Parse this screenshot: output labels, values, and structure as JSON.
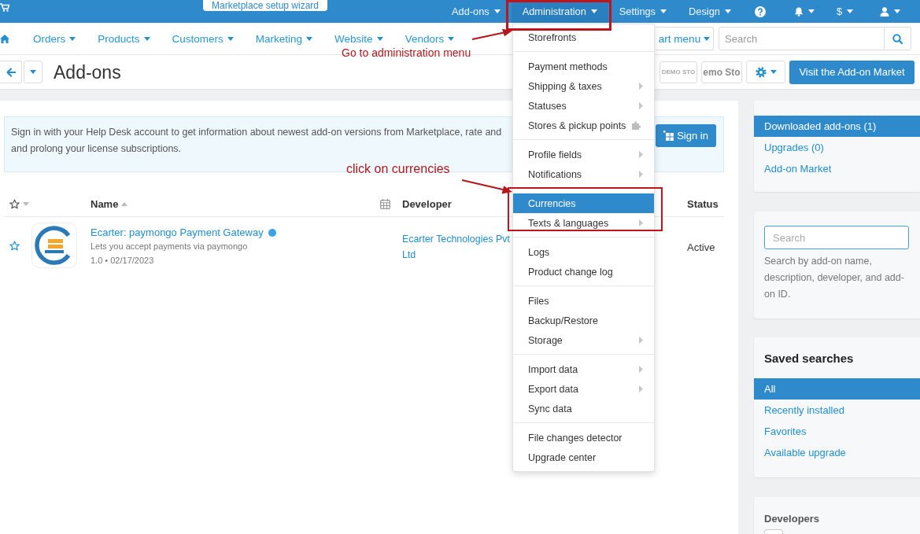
{
  "top_bar": {
    "setup_wizard": "Marketplace setup wizard",
    "menu": [
      {
        "label": "Add-ons",
        "selected": false
      },
      {
        "label": "Administration",
        "selected": true
      },
      {
        "label": "Settings",
        "selected": false
      },
      {
        "label": "Design",
        "selected": false
      }
    ],
    "currency": "$"
  },
  "nav": {
    "items": [
      "Orders",
      "Products",
      "Customers",
      "Marketing",
      "Website",
      "Vendors"
    ],
    "quick_menu": "art menu",
    "search": {
      "placeholder": "Search"
    }
  },
  "header": {
    "title": "Add-ons",
    "storefronts": [
      "DEMO STO",
      "emo Sto"
    ],
    "market_button": "Visit the Add-on Market"
  },
  "notice": {
    "lines": [
      "Sign in with your Help Desk account to get information about newest add-on versions from Marketplace, rate and",
      "and prolong your license subscriptions."
    ],
    "button": "Sign in"
  },
  "table": {
    "columns": [
      {
        "kind": "favorite"
      },
      {
        "kind": "name",
        "label": "Name",
        "sorted": true
      },
      {
        "kind": "date"
      },
      {
        "kind": "developer",
        "label": "Developer"
      },
      {
        "kind": "status",
        "label": "Status"
      }
    ],
    "rows": [
      {
        "favorite": false,
        "name": "Ecarter: paymongo Payment Gateway",
        "verified": true,
        "description": "Lets you accept payments via paymongo",
        "meta": "1.0 • 02/17/2023",
        "developer": "Ecarter Technologies Pvt Ltd",
        "status": "Active"
      }
    ]
  },
  "admin_menu": {
    "groups": [
      {
        "items": [
          {
            "label": "Storefronts",
            "kind": "link",
            "selected": false
          }
        ]
      },
      {
        "items": [
          {
            "label": "Payment methods",
            "kind": "link",
            "selected": false
          },
          {
            "label": "Shipping & taxes",
            "kind": "submenu",
            "selected": false
          },
          {
            "label": "Statuses",
            "kind": "submenu",
            "selected": false
          },
          {
            "label": "Stores & pickup points",
            "kind": "addon",
            "selected": false
          }
        ]
      },
      {
        "items": [
          {
            "label": "Profile fields",
            "kind": "submenu",
            "selected": false
          },
          {
            "label": "Notifications",
            "kind": "submenu",
            "selected": false
          }
        ]
      },
      {
        "items": [
          {
            "label": "Currencies",
            "kind": "link",
            "selected": true
          },
          {
            "label": "Texts & languages",
            "kind": "submenu",
            "selected": false
          }
        ]
      },
      {
        "items": [
          {
            "label": "Logs",
            "kind": "link",
            "selected": false
          },
          {
            "label": "Product change log",
            "kind": "link",
            "selected": false
          }
        ]
      },
      {
        "items": [
          {
            "label": "Files",
            "kind": "link",
            "selected": false
          },
          {
            "label": "Backup/Restore",
            "kind": "link",
            "selected": false
          },
          {
            "label": "Storage",
            "kind": "submenu",
            "selected": false
          }
        ]
      },
      {
        "items": [
          {
            "label": "Import data",
            "kind": "submenu",
            "selected": false
          },
          {
            "label": "Export data",
            "kind": "submenu",
            "selected": false
          },
          {
            "label": "Sync data",
            "kind": "link",
            "selected": false
          }
        ]
      },
      {
        "items": [
          {
            "label": "File changes detector",
            "kind": "link",
            "selected": false
          },
          {
            "label": "Upgrade center",
            "kind": "link",
            "selected": false
          }
        ]
      }
    ]
  },
  "sidebar": {
    "sections": [
      {
        "label": "Downloaded add-ons (1)",
        "selected": true
      },
      {
        "label": "Upgrades (0)",
        "selected": false
      },
      {
        "label": "Add-on Market",
        "selected": false
      }
    ],
    "search": {
      "placeholder": "Search",
      "hint": "Search by add-on name, description, developer, and add-on ID."
    },
    "saved_searches": {
      "title": "Saved searches",
      "items": [
        {
          "label": "All",
          "selected": true
        },
        {
          "label": "Recently installed",
          "selected": false
        },
        {
          "label": "Favorites",
          "selected": false
        },
        {
          "label": "Available upgrade",
          "selected": false
        }
      ]
    },
    "developers": {
      "title": "Developers",
      "filters": [
        {
          "checked": false
        }
      ]
    }
  },
  "annotations": [
    {
      "text": "Go to administration menu"
    },
    {
      "text": "click on currencies"
    }
  ]
}
